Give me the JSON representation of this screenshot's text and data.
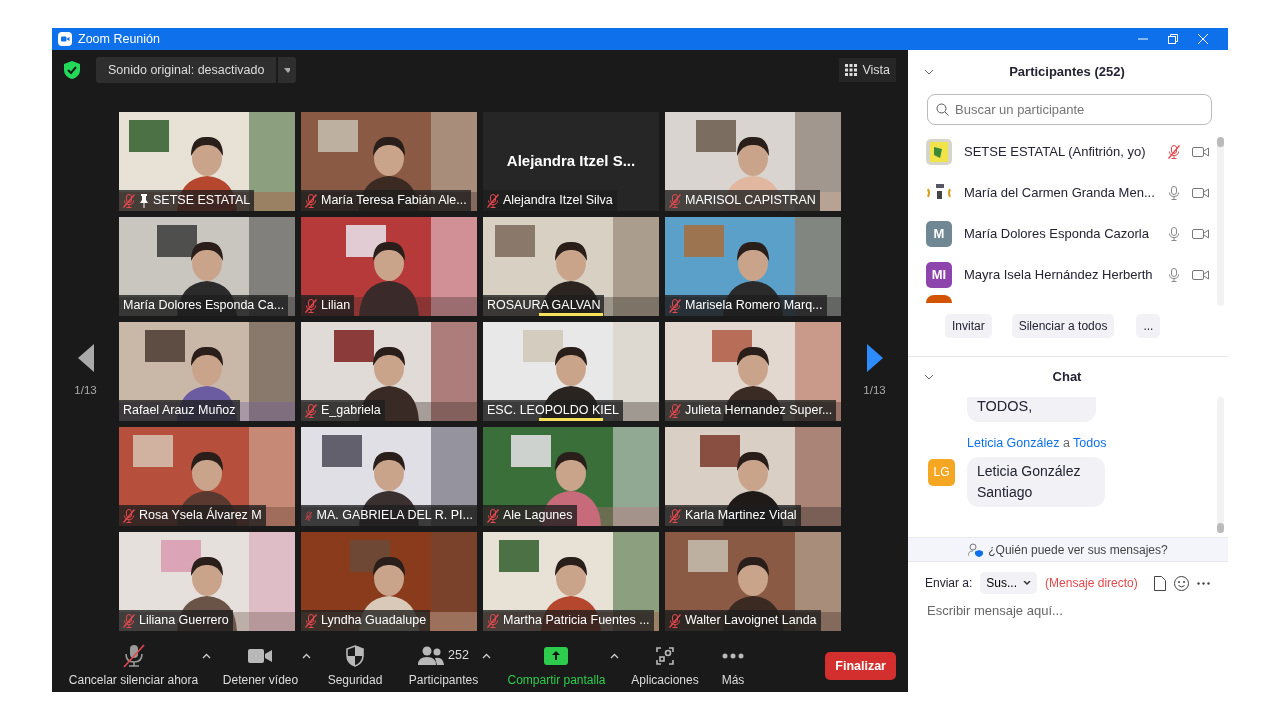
{
  "window": {
    "title": "Zoom Reunión"
  },
  "top_bar": {
    "sound_button": "Sonido original: desactivado",
    "view_button": "Vista"
  },
  "pager": {
    "left": "1/13",
    "right": "1/13"
  },
  "tiles": [
    {
      "kind": "picture",
      "name": "SETSE ESTATAL",
      "muted": true,
      "pinned": true,
      "speaking": false
    },
    {
      "kind": "picture",
      "name": "María Teresa Fabián Ale...",
      "muted": true,
      "pinned": false,
      "speaking": false
    },
    {
      "kind": "name",
      "display_name": "Alejandra  Itzel  S...",
      "name": "Alejandra Itzel Silva",
      "muted": true,
      "pinned": false,
      "speaking": false
    },
    {
      "kind": "picture",
      "name": "MARISOL CAPISTRAN",
      "muted": true,
      "pinned": false,
      "speaking": false
    },
    {
      "kind": "picture",
      "name": "María Dolores Esponda Ca...",
      "muted": false,
      "pinned": false,
      "speaking": false
    },
    {
      "kind": "picture",
      "name": "Lilian",
      "muted": true,
      "pinned": false,
      "speaking": false
    },
    {
      "kind": "picture",
      "name": "ROSAURA GALVAN",
      "muted": false,
      "pinned": false,
      "speaking": true
    },
    {
      "kind": "picture",
      "name": "Marisela Romero Marq...",
      "muted": true,
      "pinned": false,
      "speaking": false
    },
    {
      "kind": "picture",
      "name": "Rafael Arauz Muñoz",
      "muted": false,
      "pinned": false,
      "speaking": false
    },
    {
      "kind": "picture",
      "name": "E_gabriela",
      "muted": true,
      "pinned": false,
      "speaking": false
    },
    {
      "kind": "picture",
      "name": "ESC. LEOPOLDO KIEL",
      "muted": false,
      "pinned": false,
      "speaking": true
    },
    {
      "kind": "picture",
      "name": "Julieta Hernandez Super...",
      "muted": true,
      "pinned": false,
      "speaking": false
    },
    {
      "kind": "picture",
      "name": "Rosa Ysela Álvarez M",
      "muted": true,
      "pinned": false,
      "speaking": false
    },
    {
      "kind": "picture",
      "name": "MA. GABRIELA DEL R. PI...",
      "muted": true,
      "pinned": false,
      "speaking": false
    },
    {
      "kind": "picture",
      "name": "Ale Lagunes",
      "muted": true,
      "pinned": false,
      "speaking": false
    },
    {
      "kind": "picture",
      "name": "Karla Martinez Vidal",
      "muted": true,
      "pinned": false,
      "speaking": false
    },
    {
      "kind": "picture",
      "name": "Liliana Guerrero",
      "muted": true,
      "pinned": false,
      "speaking": false
    },
    {
      "kind": "picture",
      "name": "Lyndha Guadalupe",
      "muted": true,
      "pinned": false,
      "speaking": false
    },
    {
      "kind": "picture",
      "name": "Martha Patricia Fuentes ...",
      "muted": true,
      "pinned": false,
      "speaking": false
    },
    {
      "kind": "picture",
      "name": "Walter Lavoignet Landa",
      "muted": true,
      "pinned": false,
      "speaking": false
    }
  ],
  "toolbar": [
    {
      "kind": "mic-muted",
      "label": "Cancelar silenciar ahora",
      "caret": true
    },
    {
      "kind": "video",
      "label": "Detener vídeo",
      "caret": true
    },
    {
      "kind": "shield",
      "label": "Seguridad",
      "caret": false
    },
    {
      "kind": "people",
      "label": "Participantes",
      "count": "252",
      "caret": true
    },
    {
      "kind": "share",
      "label": "Compartir pantalla",
      "caret": true
    },
    {
      "kind": "apps",
      "label": "Aplicaciones",
      "caret": false
    },
    {
      "kind": "more",
      "label": "Más",
      "caret": false
    }
  ],
  "end_button": "Finalizar",
  "participants": {
    "title": "Participantes (252)",
    "search_placeholder": "Buscar un participante",
    "items": [
      {
        "kind": "logo",
        "name": "SETSE ESTATAL (Anfitrión, yo)",
        "muted": true
      },
      {
        "kind": "logo",
        "name": "María del Carmen  Granda Men...",
        "muted": false
      },
      {
        "kind": "initials",
        "initials": "M",
        "color": "#6f8894",
        "name": "María Dolores Esponda Cazorla",
        "muted": false
      },
      {
        "kind": "initials",
        "initials": "MI",
        "color": "#8e44ad",
        "name": "Mayra Isela Hernández Herberth",
        "muted": false
      },
      {
        "kind": "cut",
        "color": "#d35400"
      }
    ],
    "buttons": [
      "Invitar",
      "Silenciar a todos",
      "..."
    ]
  },
  "chat": {
    "title": "Chat",
    "messages": [
      {
        "text": "TODOS,"
      },
      {
        "sender": "Leticia González",
        "to_word": "a",
        "recipient": "Todos",
        "initials": "LG",
        "color": "#f5a623",
        "text": "Leticia González Santiago"
      }
    ],
    "privacy_note": "¿Quién puede ver sus mensajes?",
    "send_to_label": "Enviar a:",
    "send_to_value": "Sus...",
    "direct_note": "(Mensaje directo)",
    "input_placeholder": "Escribir mensaje aquí..."
  }
}
